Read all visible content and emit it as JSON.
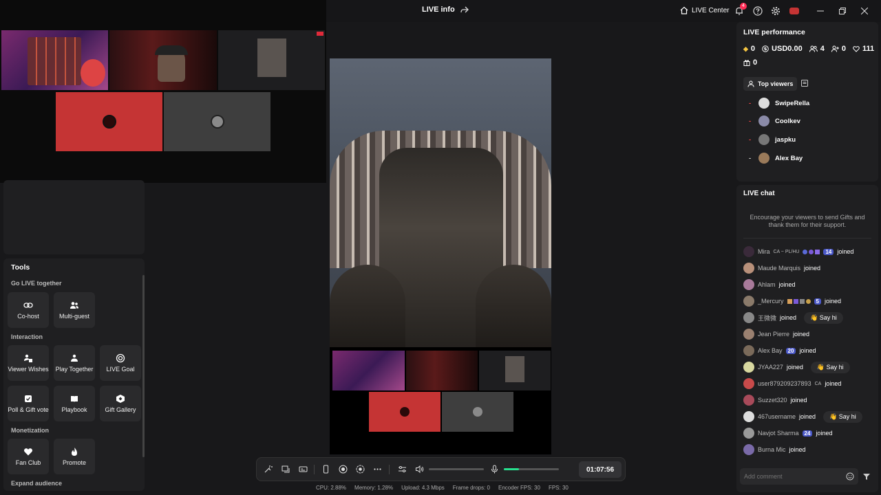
{
  "topbar": {
    "live_info": "LIVE info",
    "live_center": "LIVE Center",
    "notif_count": "4"
  },
  "left": {
    "tools_title": "Tools",
    "sections": {
      "go_live": "Go LIVE together",
      "interaction": "Interaction",
      "monetization": "Monetization",
      "expand": "Expand audience"
    },
    "buttons": {
      "cohost": "Co-host",
      "multiguest": "Multi-guest",
      "viewer_wishes": "Viewer Wishes",
      "play_together": "Play Together",
      "live_goal": "LIVE Goal",
      "poll_gift": "Poll & Gift vote",
      "playbook": "Playbook",
      "gift_gallery": "Gift Gallery",
      "fan_club": "Fan Club",
      "promote": "Promote"
    }
  },
  "performance": {
    "title": "LIVE performance",
    "diamonds": "0",
    "usd": "USD0.00",
    "viewers": "4",
    "new_followers": "0",
    "likes": "111",
    "gifts": "0",
    "top_viewers_label": "Top viewers",
    "top_viewers": [
      {
        "rank": "-",
        "name": "SwipeRella"
      },
      {
        "rank": "-",
        "name": "Coolkev"
      },
      {
        "rank": "-",
        "name": "jaspku"
      },
      {
        "rank": "-",
        "name": "Alex Bay"
      }
    ]
  },
  "chat": {
    "title": "LIVE chat",
    "hint": "Encourage your viewers to send Gifts and thank them for their support.",
    "joined": "joined",
    "say_hi": "Say hi",
    "messages": [
      {
        "name": "Mira",
        "extra": "CA ~ PL/HU",
        "badge": "14"
      },
      {
        "name": "Maude Marquis"
      },
      {
        "name": "Ahlam"
      },
      {
        "name": "_Mercury",
        "badge": "5"
      },
      {
        "name": "王微微"
      },
      {
        "name": "Jean Pierre"
      },
      {
        "name": "Alex Bay",
        "badge": "20"
      },
      {
        "name": "JYAA227"
      },
      {
        "name": "user879209237893",
        "extra": "CA"
      },
      {
        "name": "Suzzet320"
      },
      {
        "name": "467username"
      },
      {
        "name": "Navjot Sharma",
        "badge": "24"
      },
      {
        "name": "Burna Mic"
      }
    ],
    "comment_placeholder": "Add comment"
  },
  "controls": {
    "timer": "01:07:56",
    "volume_level": 0.0,
    "mic_level": 0.28
  },
  "stats": {
    "cpu": "CPU:  2.88%",
    "memory": "Memory:  1.28%",
    "upload": "Upload:  4.3 Mbps",
    "frame_drops": "Frame drops:  0",
    "encoder_fps": "Encoder FPS:  30",
    "fps": "FPS:  30"
  },
  "colors": {
    "accent": "#fe2c55",
    "mic_green": "#27e08e",
    "badge_blue": "#4a58c8",
    "guest_red": "#c53434"
  }
}
